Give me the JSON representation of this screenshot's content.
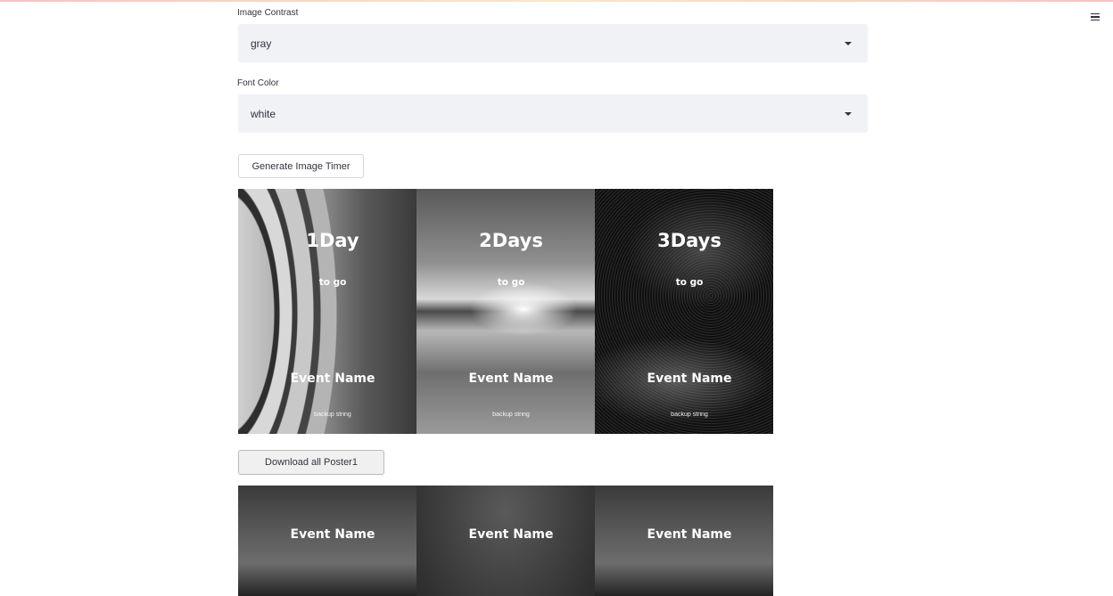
{
  "form": {
    "contrast_label": "Image Contrast",
    "contrast_value": "gray",
    "font_color_label": "Font Color",
    "font_color_value": "white",
    "generate_button": "Generate Image Timer",
    "download_button": "Download all Poster1"
  },
  "posters_row1": [
    {
      "title": "1Day",
      "subtitle": "to go",
      "event": "Event Name",
      "note": "backup string"
    },
    {
      "title": "2Days",
      "subtitle": "to go",
      "event": "Event Name",
      "note": "backup string"
    },
    {
      "title": "3Days",
      "subtitle": "to go",
      "event": "Event Name",
      "note": "backup string"
    }
  ],
  "posters_row2": [
    {
      "event": "Event Name"
    },
    {
      "event": "Event Name"
    },
    {
      "event": "Event Name"
    }
  ],
  "icons": {
    "menu": "hamburger-menu-icon",
    "dropdown": "chevron-down-icon"
  },
  "colors": {
    "select_bg": "#f0f2f6",
    "text": "#31333f"
  }
}
